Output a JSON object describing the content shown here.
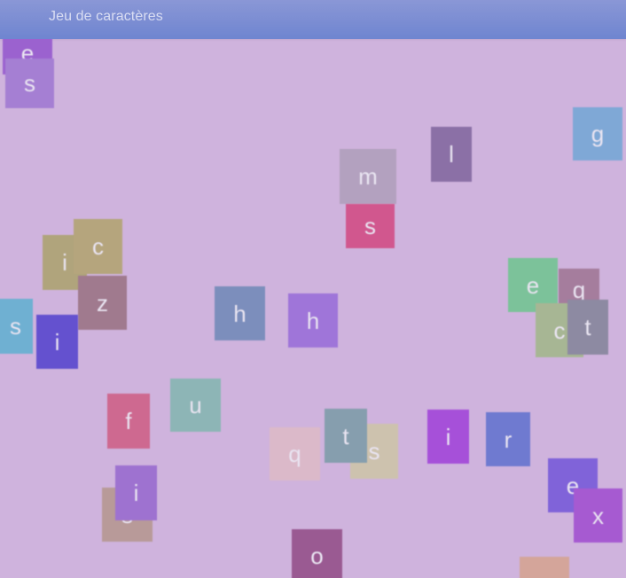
{
  "window": {
    "title": "Jeu de caractères"
  },
  "tiles": [
    {
      "letter": "e",
      "color": "#9b62cf"
    },
    {
      "letter": "s",
      "color": "#a57fd3"
    },
    {
      "letter": "g",
      "color": "#7fa8d6"
    },
    {
      "letter": "l",
      "color": "#8b70a6"
    },
    {
      "letter": "m",
      "color": "#b3a1bf"
    },
    {
      "letter": "s",
      "color": "#d1578e"
    },
    {
      "letter": "i",
      "color": "#b0a47c"
    },
    {
      "letter": "c",
      "color": "#b5a57d"
    },
    {
      "letter": "z",
      "color": "#a07a8e"
    },
    {
      "letter": "s",
      "color": "#6fb0d2"
    },
    {
      "letter": "i",
      "color": "#6451cf"
    },
    {
      "letter": "h",
      "color": "#7c8ebc"
    },
    {
      "letter": "h",
      "color": "#9f75d9"
    },
    {
      "letter": "e",
      "color": "#7cc29a"
    },
    {
      "letter": "q",
      "color": "#a57d9d"
    },
    {
      "letter": "c",
      "color": "#a7b694"
    },
    {
      "letter": "t",
      "color": "#8d8aa2"
    },
    {
      "letter": "u",
      "color": "#8db5b6"
    },
    {
      "letter": "f",
      "color": "#ce6990"
    },
    {
      "letter": "q",
      "color": "#dbb9c9"
    },
    {
      "letter": "s",
      "color": "#cdc2ae"
    },
    {
      "letter": "t",
      "color": "#869eae"
    },
    {
      "letter": "i",
      "color": "#a650d9"
    },
    {
      "letter": "r",
      "color": "#6f7ad0"
    },
    {
      "letter": "e",
      "color": "#8063d9"
    },
    {
      "letter": "x",
      "color": "#a65ad1"
    },
    {
      "letter": "s",
      "color": "#b89a99"
    },
    {
      "letter": "i",
      "color": "#9e72d0"
    },
    {
      "letter": "o",
      "color": "#9a5a92"
    },
    {
      "letter": "",
      "color": "#d4a59a"
    }
  ]
}
